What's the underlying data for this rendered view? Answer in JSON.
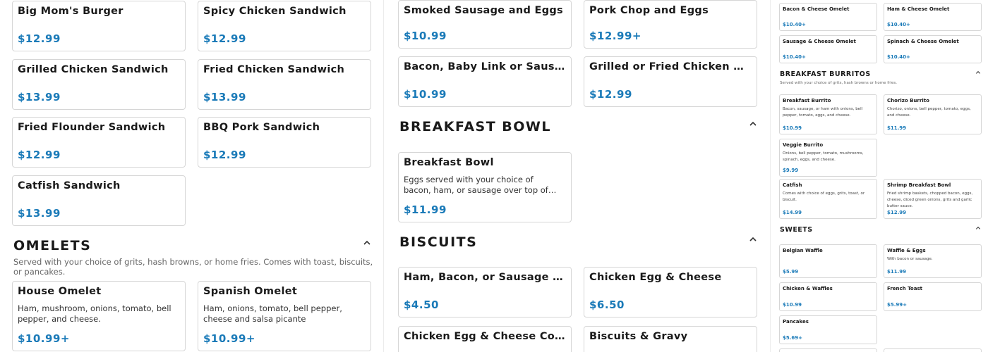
{
  "col1": {
    "items": [
      {
        "name": "Big Mom's Burger",
        "price": "$12.99"
      },
      {
        "name": "Spicy Chicken Sandwich",
        "price": "$12.99"
      },
      {
        "name": "Grilled Chicken Sandwich",
        "price": "$13.99"
      },
      {
        "name": "Fried Chicken Sandwich",
        "price": "$13.99"
      },
      {
        "name": "Fried Flounder Sandwich",
        "price": "$12.99"
      },
      {
        "name": "BBQ Pork Sandwich",
        "price": "$12.99"
      },
      {
        "name": "Catfish Sandwich",
        "price": "$13.99"
      }
    ],
    "omelets": {
      "title": "OMELETS",
      "subtitle": "Served with your choice of grits, hash browns, or home fries. Comes with toast, biscuits, or pancakes.",
      "items": [
        {
          "name": "House Omelet",
          "desc": "Ham, mushroom, onions, tomato, bell pepper, and cheese.",
          "price": "$10.99+"
        },
        {
          "name": "Spanish Omelet",
          "desc": "Ham, onions, tomato, bell pepper, cheese and salsa picante",
          "price": "$10.99+"
        }
      ]
    }
  },
  "col2": {
    "items": [
      {
        "name": "Smoked Sausage and Eggs",
        "price": "$10.99"
      },
      {
        "name": "Pork Chop and Eggs",
        "price": "$12.99+"
      },
      {
        "name": "Bacon, Baby Link or Sausage Patty and Eggs",
        "price": "$10.99"
      },
      {
        "name": "Grilled or Fried Chicken Breast and Eggs",
        "price": "$12.99"
      }
    ],
    "breakfast_bowl": {
      "title": "BREAKFAST BOWL",
      "items": [
        {
          "name": "Breakfast Bowl",
          "desc": "Eggs served with your choice of bacon, ham, or sausage over top of your choice of grits, hash browns or home fries.",
          "price": "$11.99"
        }
      ]
    },
    "biscuits": {
      "title": "BISCUITS",
      "items": [
        {
          "name": "Ham, Bacon, or Sausage Egg & Cheese",
          "price": "$4.50"
        },
        {
          "name": "Chicken Egg & Cheese",
          "price": "$6.50"
        },
        {
          "name": "Chicken Egg & Cheese Combo",
          "price": ""
        },
        {
          "name": "Biscuits & Gravy",
          "price": ""
        }
      ]
    }
  },
  "col3": {
    "omelet_items": [
      {
        "name": "Bacon & Cheese Omelet",
        "price": "$10.40+"
      },
      {
        "name": "Ham & Cheese Omelet",
        "price": "$10.40+"
      },
      {
        "name": "Sausage & Cheese Omelet",
        "price": "$10.40+"
      },
      {
        "name": "Spinach & Cheese Omelet",
        "price": "$10.40+"
      }
    ],
    "burritos": {
      "title": "BREAKFAST BURRITOS",
      "subtitle": "Served with your choice of grits, hash browns or home fries.",
      "items": [
        {
          "name": "Breakfast Burrito",
          "desc": "Bacon, sausage, or ham with onions, bell pepper, tomato, eggs, and cheese.",
          "price": "$10.99"
        },
        {
          "name": "Chorizo Burrito",
          "desc": "Chorizo, onions, bell pepper, tomato, eggs, and cheese.",
          "price": "$11.99"
        },
        {
          "name": "Veggie Burrito",
          "desc": "Onions, bell pepper, tomato, mushrooms, spinach, eggs, and cheese.",
          "price": "$9.99"
        },
        {
          "name": "Catfish",
          "desc": "Comes with choice of eggs, grits, toast, or biscuit.",
          "price": "$14.99"
        },
        {
          "name": "Shrimp Breakfast Bowl",
          "desc": "Fried shrimp baskets, chopped bacon, eggs, cheese, diced green onions, grits and garlic butter sauce.",
          "price": "$12.99"
        }
      ]
    },
    "sweets": {
      "title": "SWEETS",
      "items": [
        {
          "name": "Belgian Waffle",
          "desc": "",
          "price": "$5.99"
        },
        {
          "name": "Waffle & Eggs",
          "desc": "With bacon or sausage.",
          "price": "$11.99"
        },
        {
          "name": "Chicken & Waffles",
          "desc": "",
          "price": "$10.99"
        },
        {
          "name": "French Toast",
          "desc": "",
          "price": "$5.99+"
        },
        {
          "name": "Pancakes",
          "desc": "",
          "price": "$5.69+"
        }
      ]
    }
  },
  "icons": {
    "collapse": "chevron-up-icon"
  },
  "colors": {
    "price": "#1a7ab8",
    "border": "#d6d6d6"
  }
}
